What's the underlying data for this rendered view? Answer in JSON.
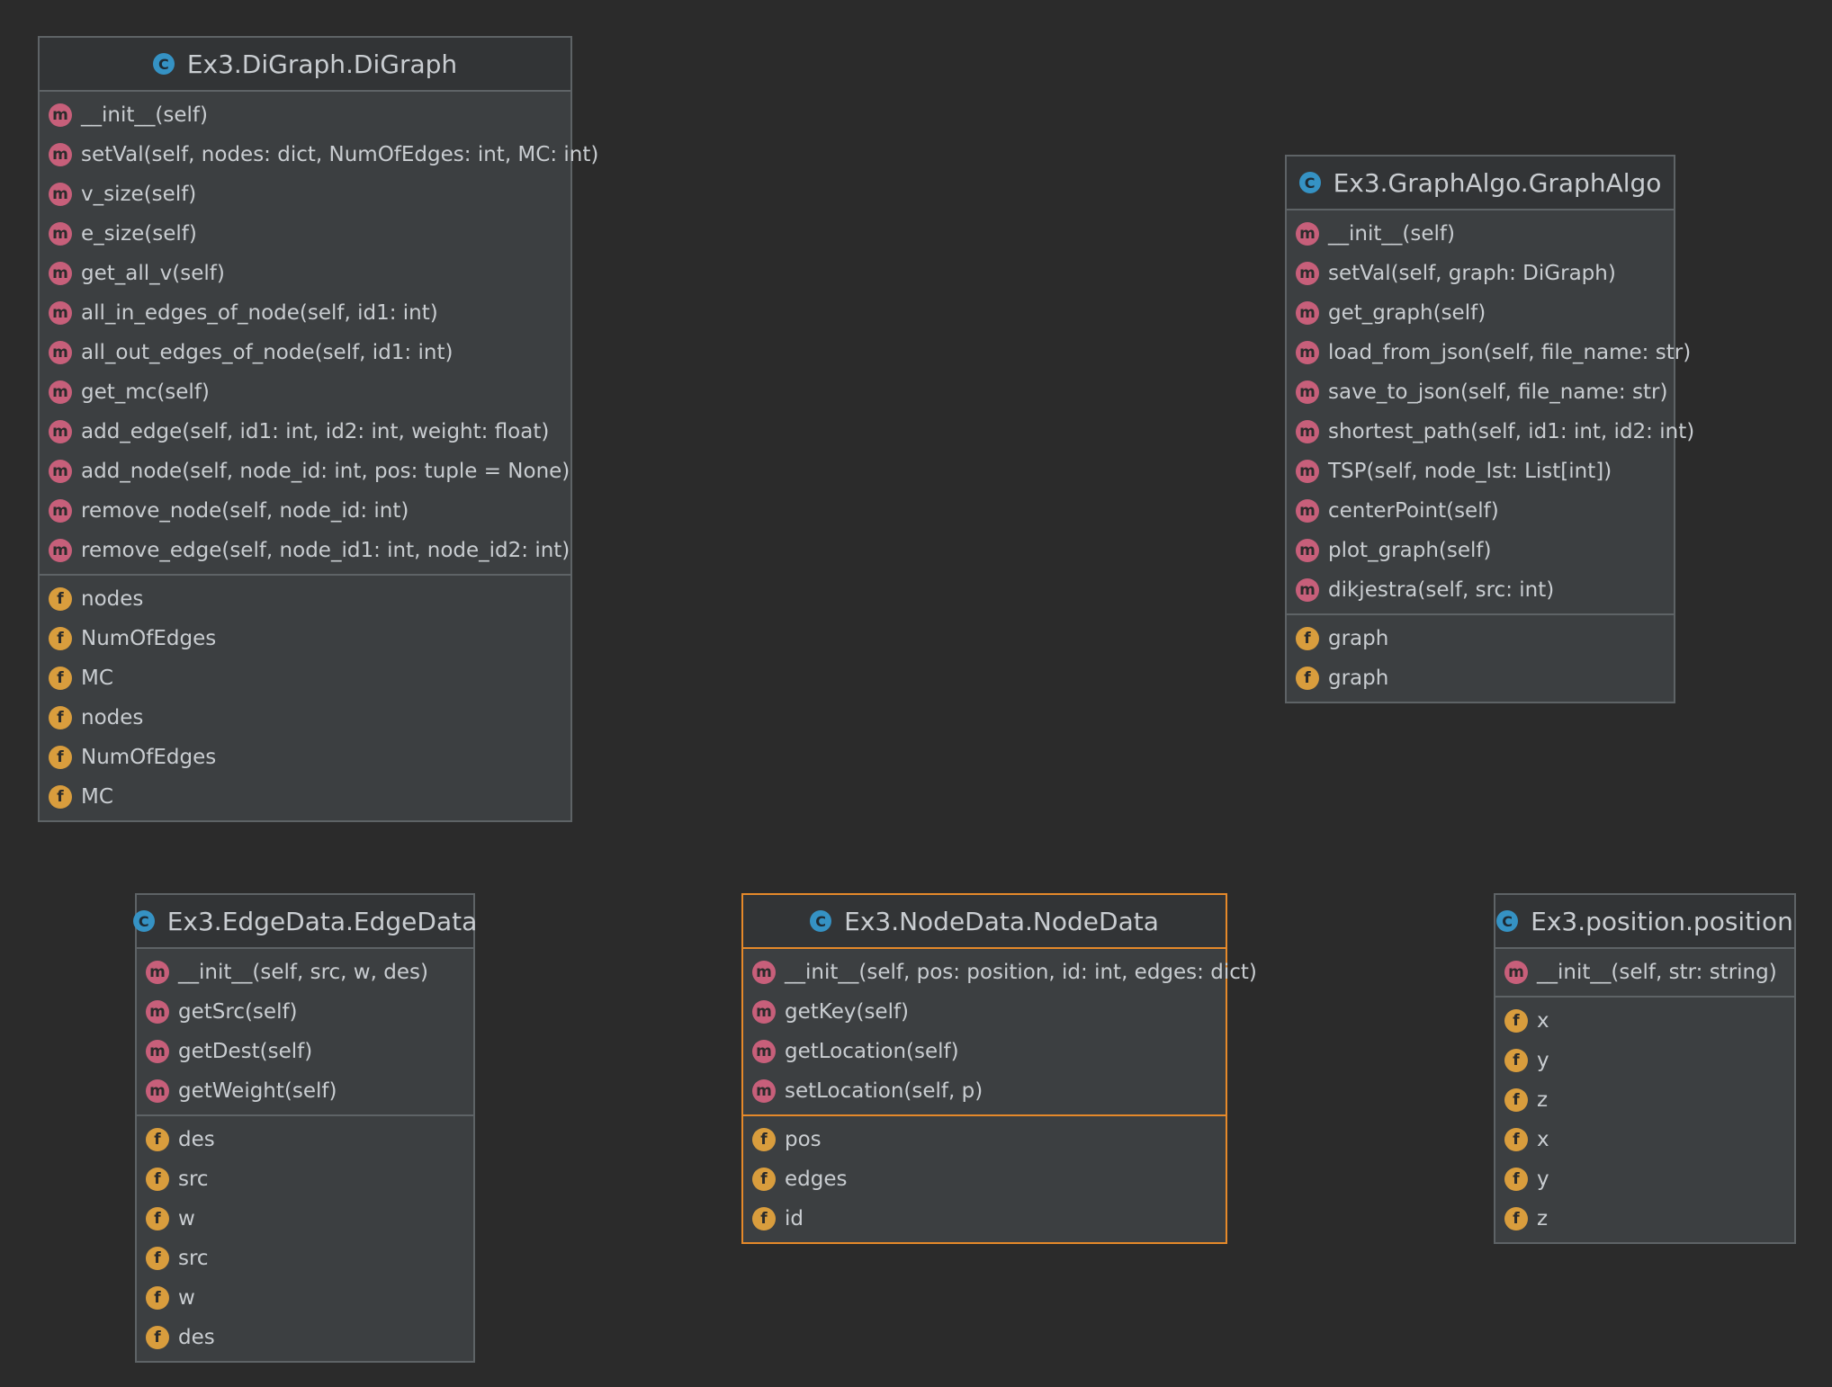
{
  "classes": {
    "digraph": {
      "name": "Ex3.DiGraph.DiGraph",
      "methods": [
        "__init__(self)",
        "setVal(self, nodes: dict, NumOfEdges: int, MC: int)",
        "v_size(self)",
        "e_size(self)",
        "get_all_v(self)",
        "all_in_edges_of_node(self, id1: int)",
        "all_out_edges_of_node(self, id1: int)",
        "get_mc(self)",
        "add_edge(self, id1: int, id2: int, weight: float)",
        "add_node(self, node_id: int, pos: tuple = None)",
        "remove_node(self, node_id: int)",
        "remove_edge(self, node_id1: int, node_id2: int)"
      ],
      "fields": [
        "nodes",
        "NumOfEdges",
        "MC",
        "nodes",
        "NumOfEdges",
        "MC"
      ]
    },
    "graphalgo": {
      "name": "Ex3.GraphAlgo.GraphAlgo",
      "methods": [
        "__init__(self)",
        "setVal(self, graph: DiGraph)",
        "get_graph(self)",
        "load_from_json(self, file_name: str)",
        "save_to_json(self, file_name: str)",
        "shortest_path(self, id1: int, id2: int)",
        "TSP(self, node_lst: List[int])",
        "centerPoint(self)",
        "plot_graph(self)",
        "dikjestra(self, src: int)"
      ],
      "fields": [
        "graph",
        "graph"
      ]
    },
    "edgedata": {
      "name": "Ex3.EdgeData.EdgeData",
      "methods": [
        "__init__(self, src, w, des)",
        "getSrc(self)",
        "getDest(self)",
        "getWeight(self)"
      ],
      "fields": [
        "des",
        "src",
        "w",
        "src",
        "w",
        "des"
      ]
    },
    "nodedata": {
      "name": "Ex3.NodeData.NodeData",
      "methods": [
        "__init__(self, pos: position, id: int, edges: dict)",
        "getKey(self)",
        "getLocation(self)",
        "setLocation(self, p)"
      ],
      "fields": [
        "pos",
        "edges",
        "id"
      ]
    },
    "position": {
      "name": "Ex3.position.position",
      "methods": [
        "__init__(self, str: string)"
      ],
      "fields": [
        "x",
        "y",
        "z",
        "x",
        "y",
        "z"
      ]
    }
  },
  "icons": {
    "class_letter": "C",
    "method_letter": "m",
    "field_letter": "f",
    "class_color": "#3592c4",
    "method_color": "#c75f7a",
    "field_color": "#d99d3d",
    "selection_color": "#e5892a"
  }
}
